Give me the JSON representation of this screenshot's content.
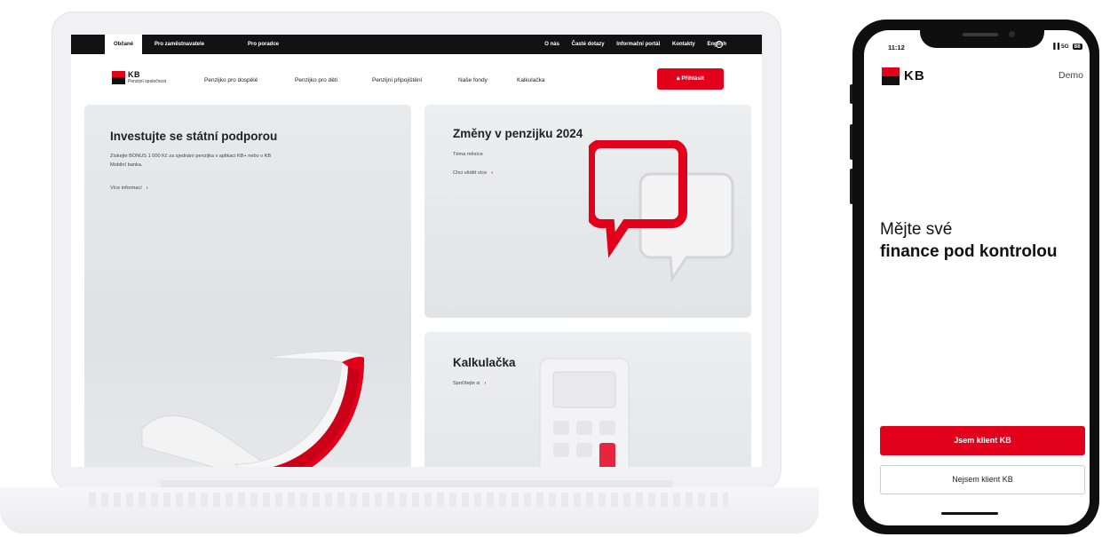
{
  "laptop": {
    "topbar": {
      "tabs": [
        "Občané",
        "Pro zaměstnavatele",
        "Pro poradce"
      ],
      "links": [
        "O nás",
        "Časté dotazy",
        "Informační portál",
        "Kontakty",
        "English"
      ]
    },
    "nav": {
      "logo_text": "KB",
      "logo_sub": "Penzijní společnost",
      "items": [
        "Penzijko pro dospělé",
        "Penzijko pro děti",
        "Penzijní připojištění",
        "Naše fondy",
        "Kalkulačka"
      ],
      "login_label": "Přihlásit"
    },
    "cards": {
      "left": {
        "title": "Investujte se státní podporou",
        "text": "Získejte BONUS 1 000 Kč za sjednání penzijka v aplikaci KB+ nebo v KB Mobilní banka.",
        "link": "Více informací"
      },
      "right_top": {
        "title": "Změny v penzijku 2024",
        "subtitle": "Téma měsíce",
        "link": "Chci vědět více"
      },
      "right_bottom": {
        "title": "Kalkulačka",
        "link": "Spočítejte si"
      }
    }
  },
  "phone": {
    "time": "11:12",
    "network": "5G",
    "battery": "88",
    "logo_text": "KB",
    "demo_label": "Demo",
    "headline_line1": "Mějte své",
    "headline_bold": "finance pod kontrolou",
    "primary_button": "Jsem klient KB",
    "secondary_button": "Nejsem klient KB"
  },
  "colors": {
    "brand_red": "#e3001b",
    "dark": "#121212"
  }
}
